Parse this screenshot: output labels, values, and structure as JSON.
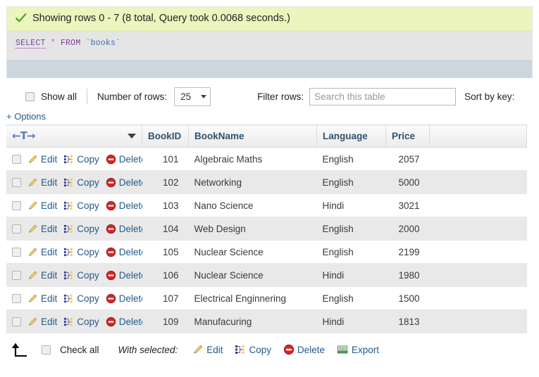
{
  "result": {
    "status_icon": "green-check-icon",
    "message": "Showing rows 0 - 7 (8 total, Query took 0.0068 seconds.)"
  },
  "query": {
    "keyword_select": "SELECT",
    "star": "*",
    "keyword_from": "FROM",
    "table_open_tick": "`",
    "table_name": "books",
    "table_close_tick": "`"
  },
  "nav": {
    "show_all_label": "Show all",
    "number_of_rows_label": "Number of rows:",
    "rows_value": "25",
    "filter_rows_label": "Filter rows:",
    "filter_placeholder": "Search this table",
    "sort_by_key_label": "Sort by key:",
    "options_label": "+ Options"
  },
  "table": {
    "sort_control": "←T→",
    "columns": [
      "BookID",
      "BookName",
      "Language",
      "Price"
    ],
    "row_actions": {
      "edit": "Edit",
      "copy": "Copy",
      "delete": "Delete"
    },
    "rows": [
      {
        "BookID": "101",
        "BookName": "Algebraic Maths",
        "Language": "English",
        "Price": "2057"
      },
      {
        "BookID": "102",
        "BookName": "Networking",
        "Language": "English",
        "Price": "5000"
      },
      {
        "BookID": "103",
        "BookName": "Nano Science",
        "Language": "Hindi",
        "Price": "3021"
      },
      {
        "BookID": "104",
        "BookName": "Web Design",
        "Language": "English",
        "Price": "2000"
      },
      {
        "BookID": "105",
        "BookName": "Nuclear Science",
        "Language": "English",
        "Price": "2199"
      },
      {
        "BookID": "106",
        "BookName": "Nuclear Science",
        "Language": "Hindi",
        "Price": "1980"
      },
      {
        "BookID": "107",
        "BookName": "Electrical Enginnering",
        "Language": "English",
        "Price": "1500"
      },
      {
        "BookID": "109",
        "BookName": "Manufacuring",
        "Language": "Hindi",
        "Price": "1813"
      }
    ]
  },
  "footer": {
    "check_all_label": "Check all",
    "with_selected_label": "With selected:",
    "edit": "Edit",
    "copy": "Copy",
    "delete": "Delete",
    "export": "Export"
  },
  "colors": {
    "success_bg": "#ebf5bd",
    "sql_bg": "#e5e5e5",
    "actionbar_bg": "#ccd6de",
    "link": "#235a8a",
    "header_text": "#30526d",
    "row_alt_bg": "#e9e9e9",
    "delete_red": "#cc2222",
    "pencil_yellow": "#f2c75c"
  }
}
